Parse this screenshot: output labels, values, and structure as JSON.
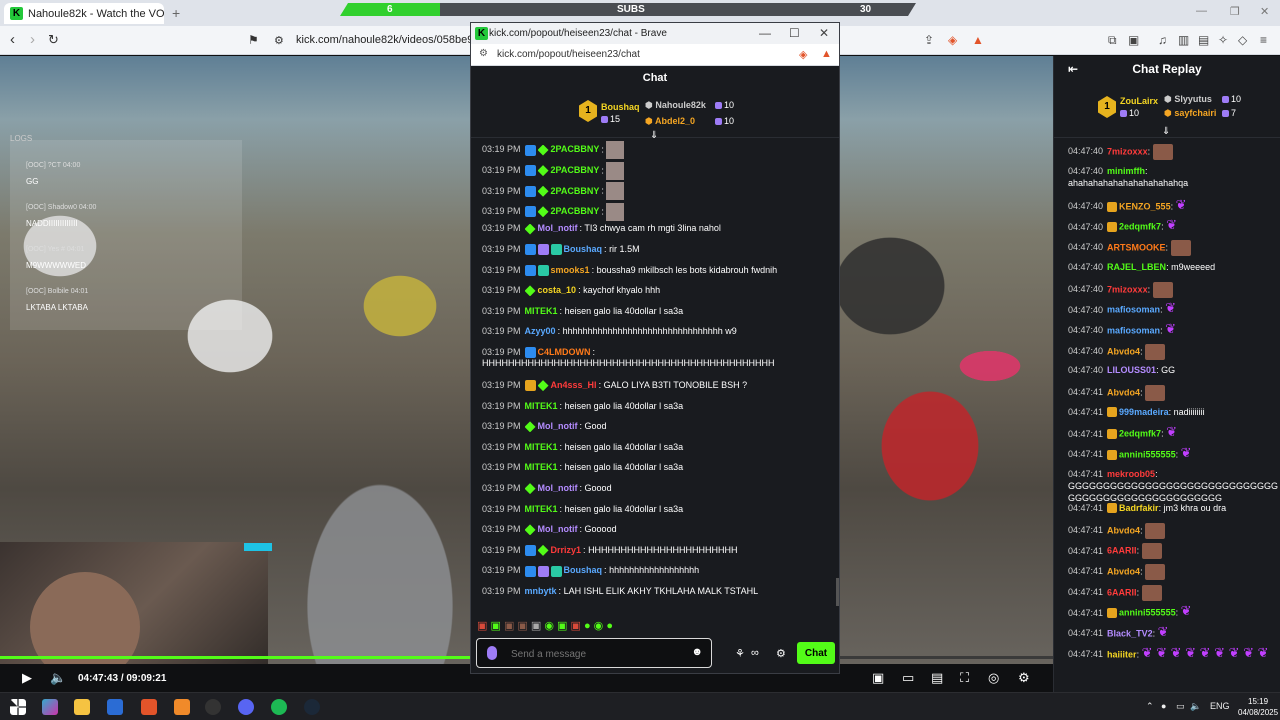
{
  "browser": {
    "tab_title": "Nahoule82k - Watch the VOD o",
    "url": "kick.com/nahoule82k/videos/058be9e8-f5",
    "subs_current": "6",
    "subs_label": "SUBS",
    "subs_goal": "30",
    "subs_fraction": 0.2
  },
  "stream_overlay": {
    "logs_title": "LOGS",
    "logs": [
      {
        "meta": "[OOC] ?CT  04:00",
        "msg": "GG"
      },
      {
        "meta": "[OOC] Shadow0  04:00",
        "msg": "NADDIIIIIIIIIIIII"
      },
      {
        "meta": "[OOC] Yes #  04:01",
        "msg": "M9WWWWWED"
      },
      {
        "meta": "[OOC] Bolbile  04:01",
        "msg": "LKTABA LKTABA"
      }
    ]
  },
  "player": {
    "current_time": "04:47:43",
    "duration": "09:09:21",
    "time_separator": "/",
    "progress_fraction": 0.522
  },
  "popout": {
    "window_title": "kick.com/popout/heiseen23/chat - Brave",
    "url": "kick.com/popout/heiseen23/chat",
    "header": "Chat",
    "top_gifters": {
      "first": {
        "name": "Boushaq",
        "count": "15",
        "rank": "1"
      },
      "second": {
        "name": "Nahoule82k",
        "count": "10"
      },
      "third": {
        "name": "Abdel2_0",
        "count": "10"
      }
    },
    "messages": [
      {
        "time": "03:19 PM",
        "user": "2PACBBNY",
        "color": "#53fc18",
        "text": "",
        "badges": [
          "blue",
          "green"
        ],
        "emote": true
      },
      {
        "time": "03:19 PM",
        "user": "2PACBBNY",
        "color": "#53fc18",
        "text": "",
        "badges": [
          "blue",
          "green"
        ],
        "emote": true
      },
      {
        "time": "03:19 PM",
        "user": "2PACBBNY",
        "color": "#53fc18",
        "text": "",
        "badges": [
          "blue",
          "green"
        ],
        "emote": true
      },
      {
        "time": "03:19 PM",
        "user": "2PACBBNY",
        "color": "#53fc18",
        "text": "",
        "badges": [
          "blue",
          "green"
        ],
        "emote": true
      },
      {
        "time": "03:19 PM",
        "user": "Mol_notif",
        "color": "#b48cff",
        "text": "TI3 chwya cam rh mgti 3lina nahol",
        "badges": [
          "green"
        ]
      },
      {
        "time": "03:19 PM",
        "user": "Boushaq",
        "color": "#5aa9ff",
        "text": "rir 1.5M",
        "badges": [
          "blue",
          "purple",
          "teal"
        ]
      },
      {
        "time": "03:19 PM",
        "user": "smooks1",
        "color": "#f5a623",
        "text": "boussha9 mkilbsch les bots kidabrouh fwdnih",
        "badges": [
          "blue",
          "teal"
        ]
      },
      {
        "time": "03:19 PM",
        "user": "costa_10",
        "color": "#f5d623",
        "text": "kaychof khyalo hhh",
        "badges": [
          "green"
        ]
      },
      {
        "time": "03:19 PM",
        "user": "MITEK1",
        "color": "#53fc18",
        "text": "heisen galo lia 40dollar l sa3a",
        "badges": []
      },
      {
        "time": "03:19 PM",
        "user": "Azyy00",
        "color": "#5aa9ff",
        "text": "hhhhhhhhhhhhhhhhhhhhhhhhhhhhhhhh w9",
        "badges": []
      },
      {
        "time": "03:19 PM",
        "user": "C4LMDOWN",
        "color": "#ff7a1a",
        "text": "",
        "badges": [
          "blue"
        ],
        "wrap": "HHHHHHHHHHHHHHHHHHHHHHHHHHHHHHHHHHHHHHHHHHHHH"
      },
      {
        "time": "03:19 PM",
        "user": "An4sss_Hl",
        "color": "#ff3b3b",
        "text": "GALO LIYA B3TI TONOBILE BSH ?",
        "badges": [
          "gold",
          "green"
        ]
      },
      {
        "time": "03:19 PM",
        "user": "MITEK1",
        "color": "#53fc18",
        "text": "heisen galo lia 40dollar l sa3a",
        "badges": []
      },
      {
        "time": "03:19 PM",
        "user": "Mol_notif",
        "color": "#b48cff",
        "text": "Good",
        "badges": [
          "green"
        ]
      },
      {
        "time": "03:19 PM",
        "user": "MITEK1",
        "color": "#53fc18",
        "text": "heisen galo lia 40dollar l sa3a",
        "badges": []
      },
      {
        "time": "03:19 PM",
        "user": "MITEK1",
        "color": "#53fc18",
        "text": "heisen galo lia 40dollar l sa3a",
        "badges": []
      },
      {
        "time": "03:19 PM",
        "user": "Mol_notif",
        "color": "#b48cff",
        "text": "Goood",
        "badges": [
          "green"
        ]
      },
      {
        "time": "03:19 PM",
        "user": "MITEK1",
        "color": "#53fc18",
        "text": "heisen galo lia 40dollar l sa3a",
        "badges": []
      },
      {
        "time": "03:19 PM",
        "user": "Mol_notif",
        "color": "#b48cff",
        "text": "Gooood",
        "badges": [
          "green"
        ]
      },
      {
        "time": "03:19 PM",
        "user": "Drrizy1",
        "color": "#ff3b3b",
        "text": "HHHHHHHHHHHHHHHHHHHHHHH",
        "badges": [
          "blue",
          "green"
        ]
      },
      {
        "time": "03:19 PM",
        "user": "Boushaq",
        "color": "#5aa9ff",
        "text": "hhhhhhhhhhhhhhhhhh",
        "badges": [
          "blue",
          "purple",
          "teal"
        ]
      },
      {
        "time": "03:19 PM",
        "user": "mnbytk",
        "color": "#5aa9ff",
        "text": "LAH ISHL ELIK AKHY TKHLAHA MALK TSTAHL",
        "badges": []
      }
    ],
    "input_placeholder": "Send a message",
    "chat_button": "Chat"
  },
  "replay": {
    "header": "Chat Replay",
    "top_gifters": {
      "first": {
        "name": "ZouLairx",
        "count": "10",
        "rank": "1"
      },
      "second": {
        "name": "Slyyutus",
        "count": "10"
      },
      "third": {
        "name": "sayfchairi",
        "count": "7"
      }
    },
    "messages": [
      {
        "time": "04:47:40",
        "user": "7mizoxxx",
        "color": "#ff3b3b",
        "text": "",
        "emote": "face"
      },
      {
        "time": "04:47:40",
        "user": "minimffh",
        "color": "#53fc18",
        "text": "",
        "wrap": "ahahahahahahahahahahahqa"
      },
      {
        "time": "04:47:40",
        "user": "KENZO_555",
        "color": "#f5a623",
        "text": "",
        "emote": "purple",
        "sub": true
      },
      {
        "time": "04:47:40",
        "user": "2edqmfk7",
        "color": "#53fc18",
        "text": "",
        "emote": "purple",
        "sub": true
      },
      {
        "time": "04:47:40",
        "user": "ARTSMOOKE",
        "color": "#ff7a1a",
        "text": "",
        "emote": "face"
      },
      {
        "time": "04:47:40",
        "user": "RAJEL_LBEN",
        "color": "#53fc18",
        "text": "m9weeeed"
      },
      {
        "time": "04:47:40",
        "user": "7mizoxxx",
        "color": "#ff3b3b",
        "text": "",
        "emote": "face"
      },
      {
        "time": "04:47:40",
        "user": "mafiosoman",
        "color": "#5aa9ff",
        "text": "",
        "emote": "purple"
      },
      {
        "time": "04:47:40",
        "user": "mafiosoman",
        "color": "#5aa9ff",
        "text": "",
        "emote": "purple"
      },
      {
        "time": "04:47:40",
        "user": "Abvdo4",
        "color": "#f5a623",
        "text": "",
        "emote": "face"
      },
      {
        "time": "04:47:40",
        "user": "LILOUSS01",
        "color": "#b48cff",
        "text": "GG"
      },
      {
        "time": "04:47:41",
        "user": "Abvdo4",
        "color": "#f5a623",
        "text": "",
        "emote": "face"
      },
      {
        "time": "04:47:41",
        "user": "999madeira",
        "color": "#5aa9ff",
        "text": "nadiiiiiiii",
        "sub": true
      },
      {
        "time": "04:47:41",
        "user": "2edqmfk7",
        "color": "#53fc18",
        "text": "",
        "emote": "purple",
        "sub": true
      },
      {
        "time": "04:47:41",
        "user": "annini555555",
        "color": "#53fc18",
        "text": "",
        "emote": "purple",
        "sub": true
      },
      {
        "time": "04:47:41",
        "user": "mekroob05",
        "color": "#ff3b3b",
        "text": "",
        "wrap": "GGGGGGGGGGGGGGGGGGGGGGGGGGGGGG GGGGGGGGGGGGGGGGGGGGGG"
      },
      {
        "time": "04:47:41",
        "user": "Badrfakir",
        "color": "#f5d623",
        "text": "jm3 khra ou dra",
        "sub": true
      },
      {
        "time": "04:47:41",
        "user": "Abvdo4",
        "color": "#f5a623",
        "text": "",
        "emote": "face"
      },
      {
        "time": "04:47:41",
        "user": "6AARII",
        "color": "#ff3b3b",
        "text": "",
        "emote": "face"
      },
      {
        "time": "04:47:41",
        "user": "Abvdo4",
        "color": "#f5a623",
        "text": "",
        "emote": "face"
      },
      {
        "time": "04:47:41",
        "user": "6AARII",
        "color": "#ff3b3b",
        "text": "",
        "emote": "face"
      },
      {
        "time": "04:47:41",
        "user": "annini555555",
        "color": "#53fc18",
        "text": "",
        "emote": "purple",
        "sub": true
      },
      {
        "time": "04:47:41",
        "user": "Black_TV2",
        "color": "#b48cff",
        "text": "",
        "emote": "purple"
      },
      {
        "time": "04:47:41",
        "user": "haiiiter",
        "color": "#f5d623",
        "text": "",
        "emote": "many"
      }
    ]
  },
  "taskbar": {
    "language": "ENG",
    "time": "15:19",
    "date": "04/08/2025"
  }
}
